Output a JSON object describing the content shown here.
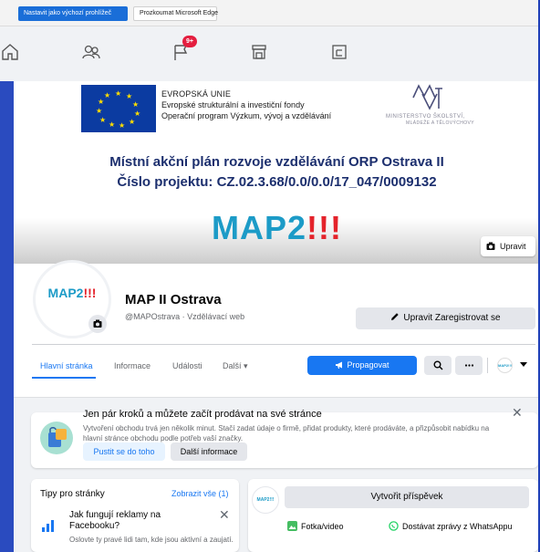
{
  "edge_bar": {
    "primary_label": "Nastavit jako výchozí prohlížeč",
    "secondary_label": "Prozkoumat Microsoft Edge"
  },
  "nav": {
    "icons": [
      "home-icon",
      "friends-icon",
      "flag-icon",
      "marketplace-icon",
      "groups-icon"
    ],
    "notification_badge": "9+"
  },
  "cover": {
    "eu_lines": [
      "EVROPSKÁ UNIE",
      "Evropské strukturální a investiční fondy",
      "Operační program Výzkum, vývoj a vzdělávání"
    ],
    "ministry_lines": [
      "MINISTERSTVO ŠKOLSTVÍ,",
      "MLÁDEŽE A TĚLOVÝCHOVY"
    ],
    "title_line1": "Místní akční plán rozvoje vzdělávání ORP Ostrava II",
    "title_line2": "Číslo projektu: CZ.02.3.68/0.0/0.0/17_047/0009132",
    "brand": "MAP2",
    "brand_exclaim": "!!!",
    "edit_label": "Upravit"
  },
  "profile": {
    "avatar_brand": "MAP2",
    "avatar_exclaim": "!!!",
    "name": "MAP II Ostrava",
    "handle": "@MAPOstrava · Vzdělávací web",
    "edit_register_label": "Upravit Zaregistrovat se"
  },
  "tabs": [
    {
      "label": "Hlavní stránka",
      "active": true
    },
    {
      "label": "Informace",
      "active": false
    },
    {
      "label": "Události",
      "active": false
    },
    {
      "label": "Další ▾",
      "active": false
    }
  ],
  "actions": {
    "promote_label": "Propagovat",
    "account_avatar_text": "MAP2!!!"
  },
  "shop": {
    "title": "Jen pár kroků a můžete začít prodávat na své stránce",
    "description": "Vytvoření obchodu trvá jen několik minut. Stačí zadat údaje o firmě, přidat produkty, které prodáváte, a přizpůsobit nabídku na hlavní stránce obchodu podle potřeb vaší značky.",
    "start_label": "Pustit se do toho",
    "info_label": "Další informace"
  },
  "tips": {
    "title": "Tipy pro stránky",
    "see_all": "Zobrazit vše (1)",
    "item_title": "Jak fungují reklamy na Facebooku?",
    "item_desc": "Oslovte ty pravé lidi tam, kde jsou aktivní a zaujatí."
  },
  "composer": {
    "avatar_text": "MAP2!!!",
    "create_post_label": "Vytvořit příspěvek",
    "photo_label": "Fotka/video",
    "whatsapp_label": "Dostávat zprávy z WhatsAppu"
  },
  "colors": {
    "facebook_blue": "#1877f2",
    "brand_teal": "#1c9bc7",
    "brand_red": "#e4232b",
    "frame_blue": "#1f3fb8"
  }
}
